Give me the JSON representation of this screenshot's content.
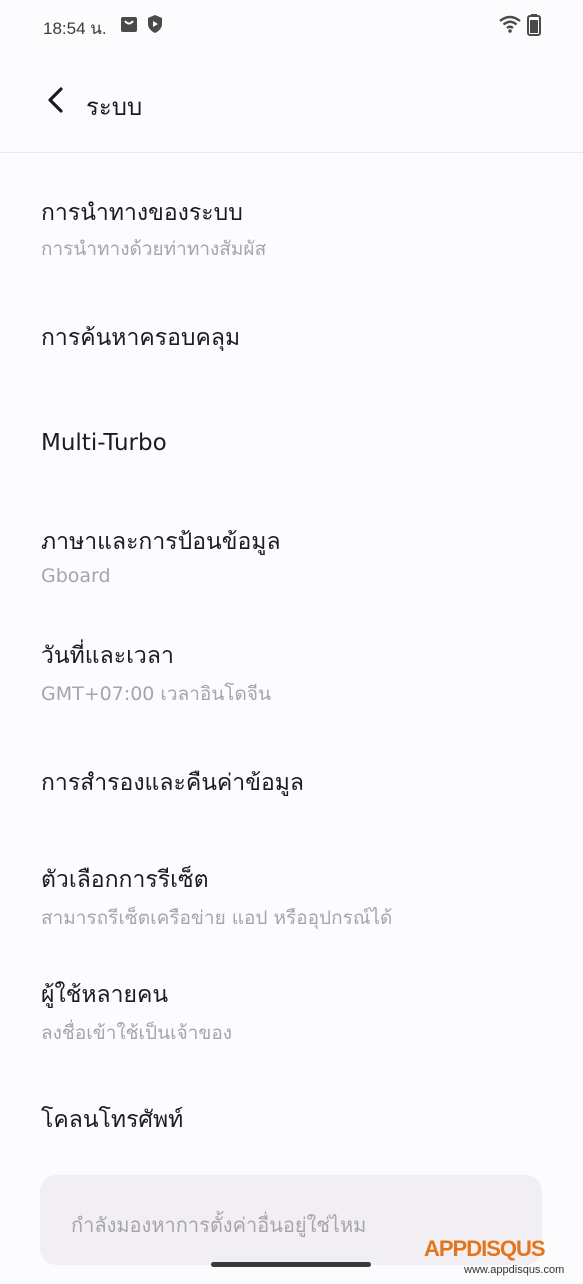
{
  "status_bar": {
    "time": "18:54 น."
  },
  "header": {
    "title": "ระบบ"
  },
  "items": [
    {
      "title": "การนำทางของระบบ",
      "subtitle": "การนำทางด้วยท่าทางสัมผัส"
    },
    {
      "title": "การค้นหาครอบคลุม"
    },
    {
      "title": "Multi-Turbo"
    },
    {
      "title": "ภาษาและการป้อนข้อมูล",
      "subtitle": "Gboard"
    },
    {
      "title": "วันที่และเวลา",
      "subtitle": "GMT+07:00 เวลาอินโดจีน"
    },
    {
      "title": "การสำรองและคืนค่าข้อมูล"
    },
    {
      "title": "ตัวเลือกการรีเซ็ต",
      "subtitle": "สามารถรีเซ็ตเครือข่าย แอป หรืออุปกรณ์ได้"
    },
    {
      "title": "ผู้ใช้หลายคน",
      "subtitle": "ลงชื่อเข้าใช้เป็นเจ้าของ"
    },
    {
      "title": "โคลนโทรศัพท์"
    }
  ],
  "search_card": {
    "text": "กำลังมองหาการตั้งค่าอื่นอยู่ใช่ไหม"
  },
  "watermark": {
    "logo": "APPDISQUS",
    "url": "www.appdisqus.com"
  },
  "icons": {
    "notification": "bag-icon",
    "shield": "shield-icon",
    "wifi": "wifi-icon",
    "battery": "battery-icon",
    "back": "chevron-left-icon"
  }
}
